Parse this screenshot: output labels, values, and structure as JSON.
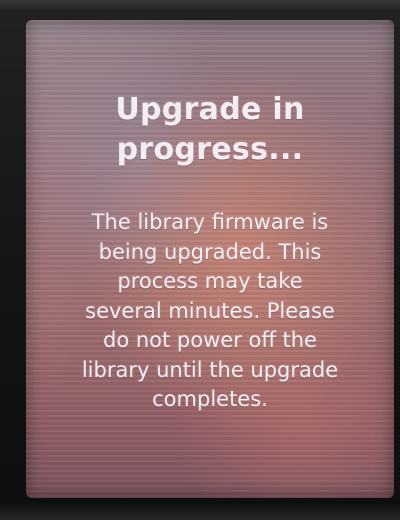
{
  "dialog": {
    "title_line1": "Upgrade in",
    "title_line2": "progress...",
    "message_lines": [
      "The library firmware is",
      "being upgraded. This",
      "process may take",
      "several minutes. Please",
      "do not power off the",
      "library until the upgrade",
      "completes."
    ]
  },
  "colors": {
    "text": "#f4eef4",
    "screen_tint": "#9a7077",
    "bezel": "#1b1b1b"
  }
}
